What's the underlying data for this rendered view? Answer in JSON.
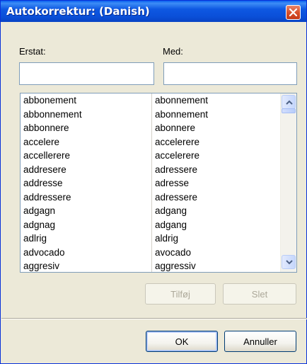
{
  "window": {
    "title": "Autokorrektur: (Danish)"
  },
  "labels": {
    "replace": "Erstat:",
    "with": "Med:"
  },
  "inputs": {
    "replace_value": "",
    "with_value": ""
  },
  "list": {
    "rows": [
      {
        "from": "abbonement",
        "to": "abonnement"
      },
      {
        "from": "abbonnement",
        "to": "abonnement"
      },
      {
        "from": "abbonnere",
        "to": "abonnere"
      },
      {
        "from": "accelere",
        "to": "accelerere"
      },
      {
        "from": "accellerere",
        "to": "accelerere"
      },
      {
        "from": "addresere",
        "to": "adressere"
      },
      {
        "from": "addresse",
        "to": "adresse"
      },
      {
        "from": "addressere",
        "to": "adressere"
      },
      {
        "from": "adgagn",
        "to": "adgang"
      },
      {
        "from": "adgnag",
        "to": "adgang"
      },
      {
        "from": "adlrig",
        "to": "aldrig"
      },
      {
        "from": "advocado",
        "to": "avocado"
      },
      {
        "from": "aggresiv",
        "to": "aggressiv"
      }
    ]
  },
  "buttons": {
    "add": "Tilføj",
    "delete": "Slet",
    "ok": "OK",
    "cancel": "Annuller"
  },
  "icons": {
    "close": "close-icon",
    "scroll_up": "chevron-up-icon",
    "scroll_down": "chevron-down-icon"
  },
  "colors": {
    "titlebar": "#0A4FD8",
    "dialog_bg": "#ECE9D8",
    "close_button": "#D8512C"
  }
}
